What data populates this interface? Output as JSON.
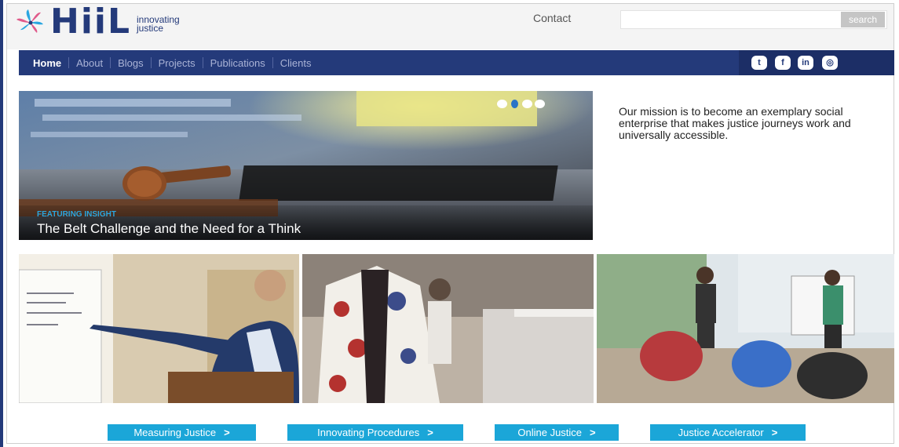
{
  "brand": {
    "logo_name": "HiiL",
    "tagline_line1": "innovating",
    "tagline_line2": "justice"
  },
  "header": {
    "contact_label": "Contact",
    "search_placeholder": "",
    "search_button_label": "search"
  },
  "nav": {
    "items": [
      {
        "label": "Home",
        "active": true
      },
      {
        "label": "About"
      },
      {
        "label": "Blogs"
      },
      {
        "label": "Projects"
      },
      {
        "label": "Publications"
      },
      {
        "label": "Clients"
      }
    ],
    "social_icons": [
      "twitter-icon",
      "facebook-icon",
      "linkedin-icon",
      "instagram-icon"
    ]
  },
  "hero": {
    "kicker": "FEATURING INSIGHT",
    "title": "The Belt Challenge and the Need for a Think",
    "carousel_active_index": 1,
    "carousel_count": 4
  },
  "mission": {
    "text": "Our mission is to become an exemplary social enterprise that makes justice journeys work and universally accessible."
  },
  "gallery": {
    "images": [
      "presenter-at-flipchart",
      "exhibited-robe",
      "audience-workshop"
    ]
  },
  "cta": {
    "buttons": [
      {
        "label": "Measuring Justice"
      },
      {
        "label": "Innovating Procedures"
      },
      {
        "label": "Online Justice"
      },
      {
        "label": "Justice Accelerator"
      }
    ],
    "arrow": ">"
  },
  "colors": {
    "navy": "#243a7a",
    "accent": "#1ba6d8",
    "logo_pink": "#e05a8a"
  }
}
